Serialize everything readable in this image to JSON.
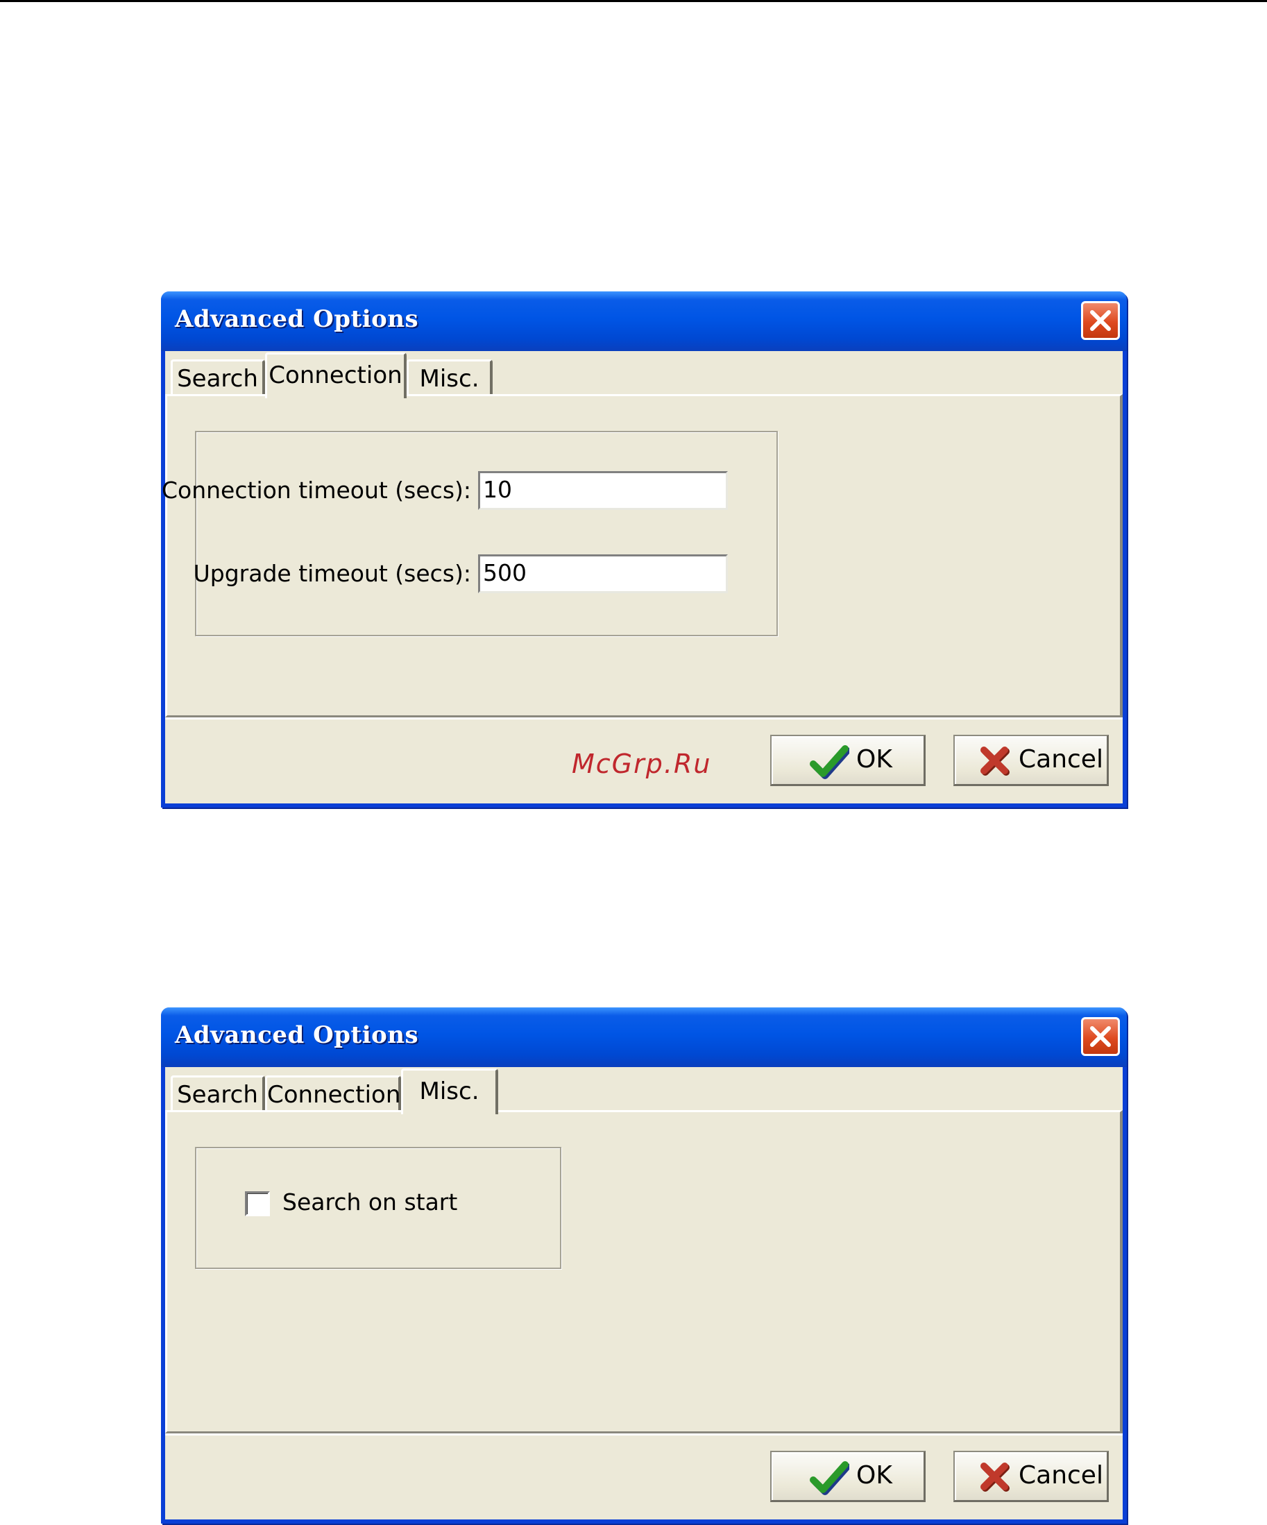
{
  "dialogs": [
    {
      "title": "Advanced Options",
      "tabs": [
        "Search",
        "Connection",
        "Misc."
      ],
      "active_tab": "Connection",
      "fields": {
        "connection_timeout": {
          "label": "Connection timeout (secs):",
          "value": "10"
        },
        "upgrade_timeout": {
          "label": "Upgrade timeout (secs):",
          "value": "500"
        }
      },
      "buttons": {
        "ok": "OK",
        "cancel": "Cancel"
      },
      "watermark": "McGrp.Ru"
    },
    {
      "title": "Advanced Options",
      "tabs": [
        "Search",
        "Connection",
        "Misc."
      ],
      "active_tab": "Misc.",
      "checkbox": {
        "label": "Search on start",
        "checked": false
      },
      "buttons": {
        "ok": "OK",
        "cancel": "Cancel"
      }
    }
  ],
  "icons": {
    "close": "close-icon",
    "ok": "checkmark-icon",
    "cancel": "x-icon"
  },
  "colors": {
    "titlebar": "#0055e5",
    "dialog_face": "#ece9d8",
    "close_button": "#de4a20",
    "ok_check": "#2a9a2a",
    "cancel_x": "#c0392b",
    "watermark": "#c0272d"
  }
}
